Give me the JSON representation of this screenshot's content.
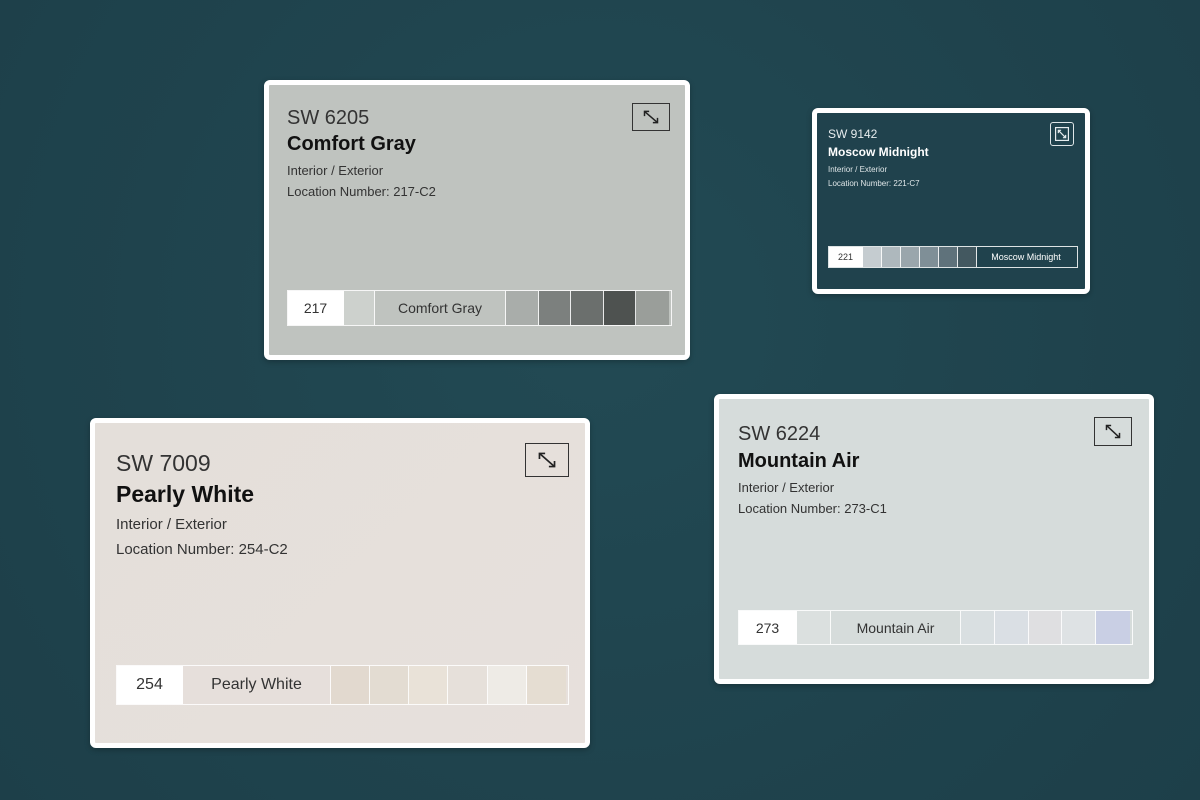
{
  "cards": [
    {
      "code": "SW 6205",
      "name": "Comfort Gray",
      "availability": "Interior / Exterior",
      "location": "Location Number: 217-C2",
      "background": "#bfc3bf",
      "strip": {
        "number": "217",
        "label": "Comfort Gray",
        "swatches_before": [
          "#cdd1cd"
        ],
        "swatches_after": [
          "#a9adaa",
          "#7c807e",
          "#6b6f6d",
          "#4e5250",
          "#9a9e9a"
        ]
      }
    },
    {
      "code": "SW 9142",
      "name": "Moscow Midnight",
      "availability": "Interior / Exterior",
      "location": "Location Number: 221-C7",
      "background": "#20424d",
      "strip": {
        "number": "221",
        "label": "Moscow Midnight",
        "swatches_before": [
          "#c5ccd0",
          "#aeb8bd",
          "#9aa6ac",
          "#7f8f97",
          "#5f727b",
          "#435860"
        ]
      }
    },
    {
      "code": "SW 7009",
      "name": "Pearly White",
      "availability": "Interior / Exterior",
      "location": "Location Number: 254-C2",
      "background": "#e6dfdb",
      "strip": {
        "number": "254",
        "label": "Pearly White",
        "swatches_after": [
          "#e2d9cf",
          "#e3dcd2",
          "#e9e2d8",
          "#e6e0da",
          "#eeebe6",
          "#e5ddd2"
        ]
      }
    },
    {
      "code": "SW 6224",
      "name": "Mountain Air",
      "availability": "Interior / Exterior",
      "location": "Location Number: 273-C1",
      "background": "#d6dcdb",
      "strip": {
        "number": "273",
        "label": "Mountain Air",
        "swatches_before": [
          "#dbe0df"
        ],
        "swatches_after": [
          "#d9dfe1",
          "#dadfe4",
          "#dfdfe1",
          "#dee2e4",
          "#c9cfe4"
        ]
      }
    }
  ]
}
